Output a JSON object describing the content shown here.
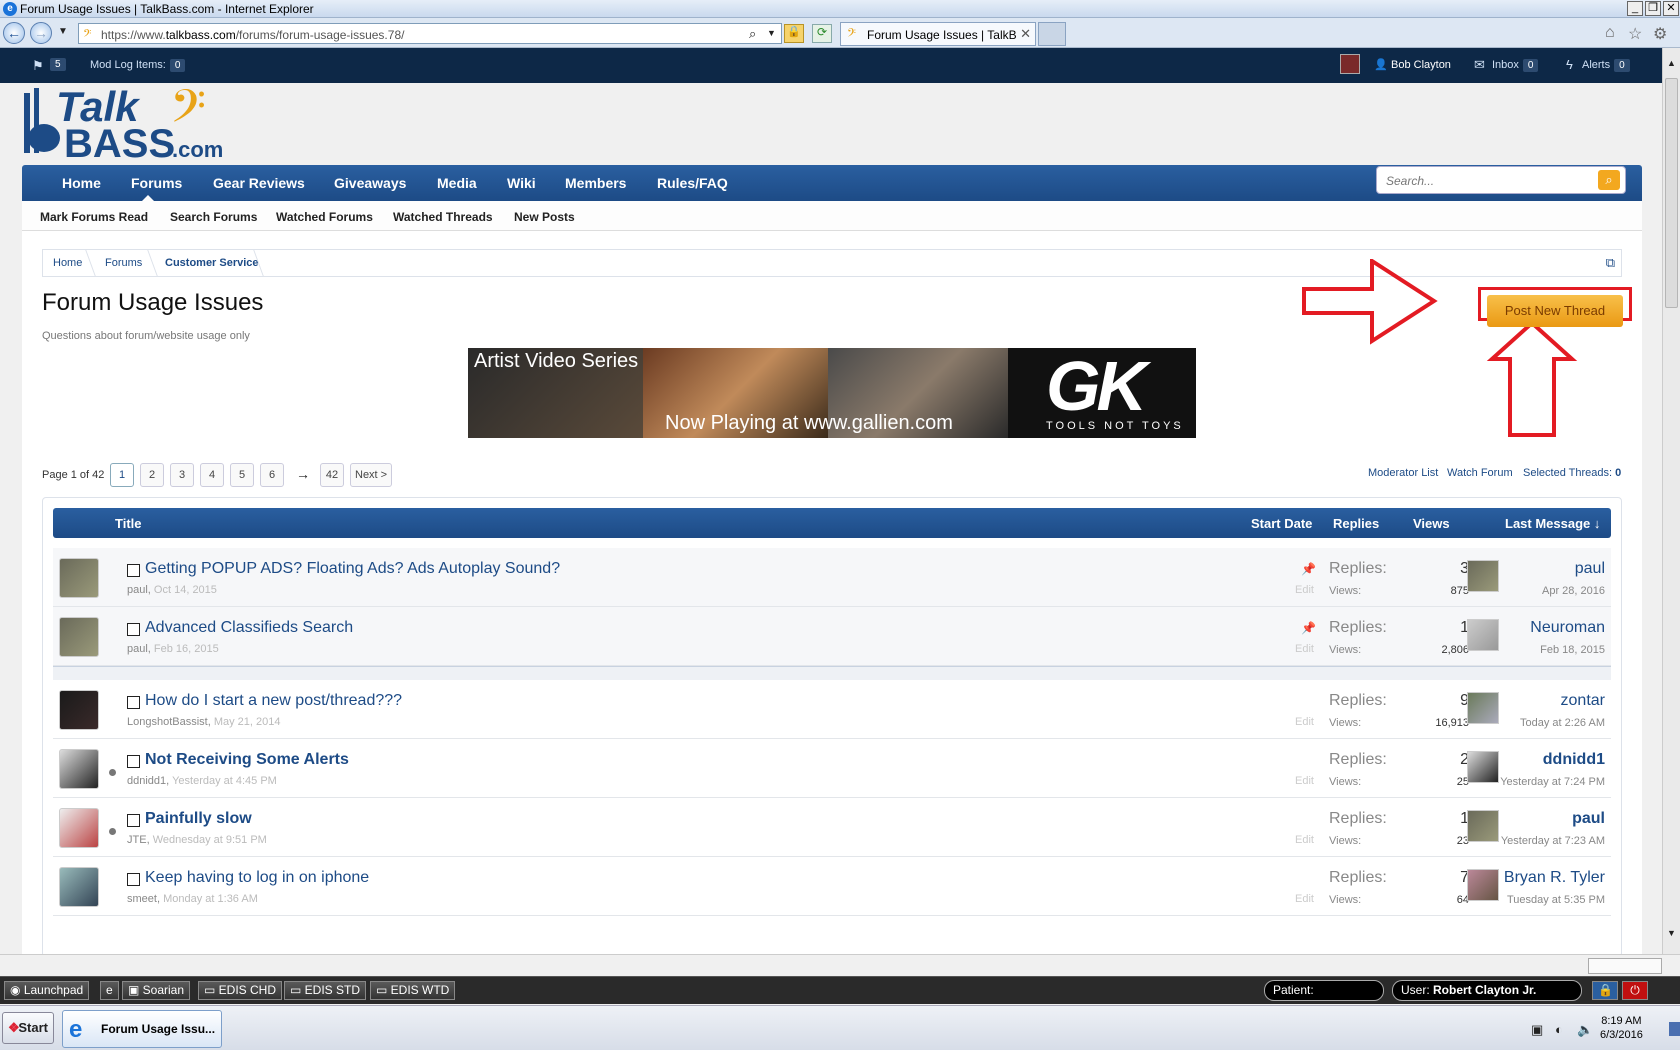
{
  "window": {
    "title": "Forum Usage Issues | TalkBass.com - Internet Explorer"
  },
  "browser": {
    "url_prefix": "https://www.",
    "url_domain": "talkbass.com",
    "url_path": "/forums/forum-usage-issues.78/",
    "tab_title": "Forum Usage Issues | TalkBa..."
  },
  "topbar": {
    "flag_count": "5",
    "modlog_label": "Mod Log Items:",
    "modlog_count": "0",
    "user": "Bob Clayton",
    "inbox_label": "Inbox",
    "inbox_count": "0",
    "alerts_label": "Alerts",
    "alerts_count": "0"
  },
  "logo": {
    "text_top": "Talk",
    "text_bottom": "BASS",
    "text_com": ".com"
  },
  "mainnav": {
    "items": [
      "Home",
      "Forums",
      "Gear Reviews",
      "Giveaways",
      "Media",
      "Wiki",
      "Members",
      "Rules/FAQ"
    ]
  },
  "search": {
    "placeholder": "Search..."
  },
  "subnav": {
    "items": [
      "Mark Forums Read",
      "Search Forums",
      "Watched Forums",
      "Watched Threads",
      "New Posts"
    ]
  },
  "breadcrumb": [
    "Home",
    "Forums",
    "Customer Service"
  ],
  "forum": {
    "title": "Forum Usage Issues",
    "description": "Questions about forum/website usage only",
    "post_new_thread": "Post New Thread"
  },
  "banner": {
    "title": "Artist Video Series",
    "subtitle": "Now Playing at www.gallien.com",
    "brand": "GK",
    "tagline": "TOOLS NOT TOYS"
  },
  "pagination": {
    "label": "Page 1 of 42",
    "pages": [
      "1",
      "2",
      "3",
      "4",
      "5",
      "6"
    ],
    "arrow": "→",
    "last": "42",
    "next": "Next >"
  },
  "right_links": {
    "moderator_list": "Moderator List",
    "watch_forum": "Watch Forum",
    "selected_label": "Selected Threads:",
    "selected_count": "0"
  },
  "table": {
    "headers": {
      "title": "Title",
      "start_date": "Start Date",
      "replies": "Replies",
      "views": "Views",
      "last_message": "Last Message ↓"
    },
    "replies_label": "Replies:",
    "views_label": "Views:",
    "edit_label": "Edit",
    "rows": [
      {
        "title": "Getting POPUP ADS? Floating Ads? Ads Autoplay Sound?",
        "author": "paul",
        "date": "Oct 14, 2015",
        "replies": "3",
        "views": "875",
        "last_user": "paul",
        "last_date": "Apr 28, 2016"
      },
      {
        "title": "Advanced Classifieds Search",
        "author": "paul",
        "date": "Feb 16, 2015",
        "replies": "1",
        "views": "2,806",
        "last_user": "Neuroman",
        "last_date": "Feb 18, 2015"
      },
      {
        "title": "How do I start a new post/thread???",
        "author": "LongshotBassist",
        "date": "May 21, 2014",
        "replies": "9",
        "views": "16,913",
        "last_user": "zontar",
        "last_date": "Today at 2:26 AM"
      },
      {
        "title": "Not Receiving Some Alerts",
        "author": "ddnidd1",
        "date": "Yesterday at 4:45 PM",
        "replies": "2",
        "views": "25",
        "last_user": "ddnidd1",
        "last_date": "Yesterday at 7:24 PM"
      },
      {
        "title": "Painfully slow",
        "author": "JTE",
        "date": "Wednesday at 9:51 PM",
        "replies": "1",
        "views": "23",
        "last_user": "paul",
        "last_date": "Yesterday at 7:23 AM"
      },
      {
        "title": "Keep having to log in on iphone",
        "author": "smeet",
        "date": "Monday at 1:36 AM",
        "replies": "7",
        "views": "64",
        "last_user": "Bryan R. Tyler",
        "last_date": "Tuesday at 5:35 PM"
      }
    ]
  },
  "appbar": {
    "launchpad": "Launchpad",
    "soarian": "Soarian",
    "edis_chd": "EDIS CHD",
    "edis_std": "EDIS STD",
    "edis_wtd": "EDIS WTD",
    "patient_label": "Patient:",
    "user_label": "User:",
    "user_name": "Robert Clayton Jr."
  },
  "taskbar": {
    "start": "Start",
    "ie_item": "Forum Usage Issu...",
    "time": "8:19 AM",
    "date": "6/3/2016"
  },
  "colors": {
    "nav_blue": "#1d4b86",
    "accent_orange": "#f3a81f",
    "annotation_red": "#e31b23"
  }
}
